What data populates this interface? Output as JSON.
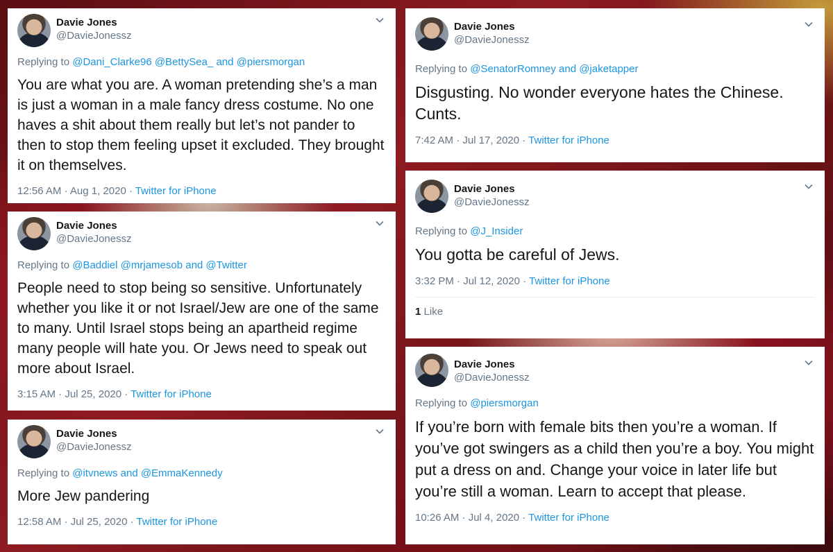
{
  "tweets": [
    {
      "name": "Davie Jones",
      "handle": "@DavieJonessz",
      "replying_prefix": "Replying to ",
      "mentions": "@Dani_Clarke96 @BettySea_ and @piersmorgan",
      "text": "You are what you are.  A woman pretending she’s a man is just a woman in a male fancy dress costume. No one haves a shit about them really but let’s not pander to then to stop them feeling upset it excluded. They brought it on themselves.",
      "timestamp": "12:56 AM · Aug 1, 2020 · ",
      "source": "Twitter for iPhone"
    },
    {
      "name": "Davie Jones",
      "handle": "@DavieJonessz",
      "replying_prefix": "Replying to ",
      "mentions": "@Baddiel @mrjamesob and @Twitter",
      "text": "People need to stop being so sensitive. Unfortunately whether you like it or not Israel/Jew are one of the same to many. Until Israel stops being an apartheid regime many people will hate you. Or Jews need to speak out more about Israel.",
      "timestamp": "3:15 AM · Jul 25, 2020 · ",
      "source": "Twitter for iPhone"
    },
    {
      "name": "Davie Jones",
      "handle": "@DavieJonessz",
      "replying_prefix": "Replying to ",
      "mentions": "@itvnews and @EmmaKennedy",
      "text": "More Jew pandering",
      "timestamp": "12:58 AM · Jul 25, 2020 · ",
      "source": "Twitter for iPhone"
    },
    {
      "name": "Davie Jones",
      "handle": "@DavieJonessz",
      "replying_prefix": "Replying to ",
      "mentions": "@SenatorRomney and @jaketapper",
      "text": "Disgusting. No wonder everyone hates the Chinese. Cunts.",
      "timestamp": "7:42 AM · Jul 17, 2020 · ",
      "source": "Twitter for iPhone"
    },
    {
      "name": "Davie Jones",
      "handle": "@DavieJonessz",
      "replying_prefix": "Replying to ",
      "mentions": "@J_Insider",
      "text": "You gotta be careful of Jews.",
      "timestamp": "3:32 PM · Jul 12, 2020 · ",
      "source": "Twitter for iPhone",
      "like_count": "1",
      "like_label": "Like"
    },
    {
      "name": "Davie Jones",
      "handle": "@DavieJonessz",
      "replying_prefix": "Replying to ",
      "mentions": "@piersmorgan",
      "text": "If you’re born with female bits then you’re a woman. If you’ve got swingers as a child then you’re a boy. You might put a dress on and. Change your voice in later life but you’re still a woman. Learn to accept that please.",
      "timestamp": "10:26 AM · Jul 4, 2020 · ",
      "source": "Twitter for iPhone"
    }
  ]
}
